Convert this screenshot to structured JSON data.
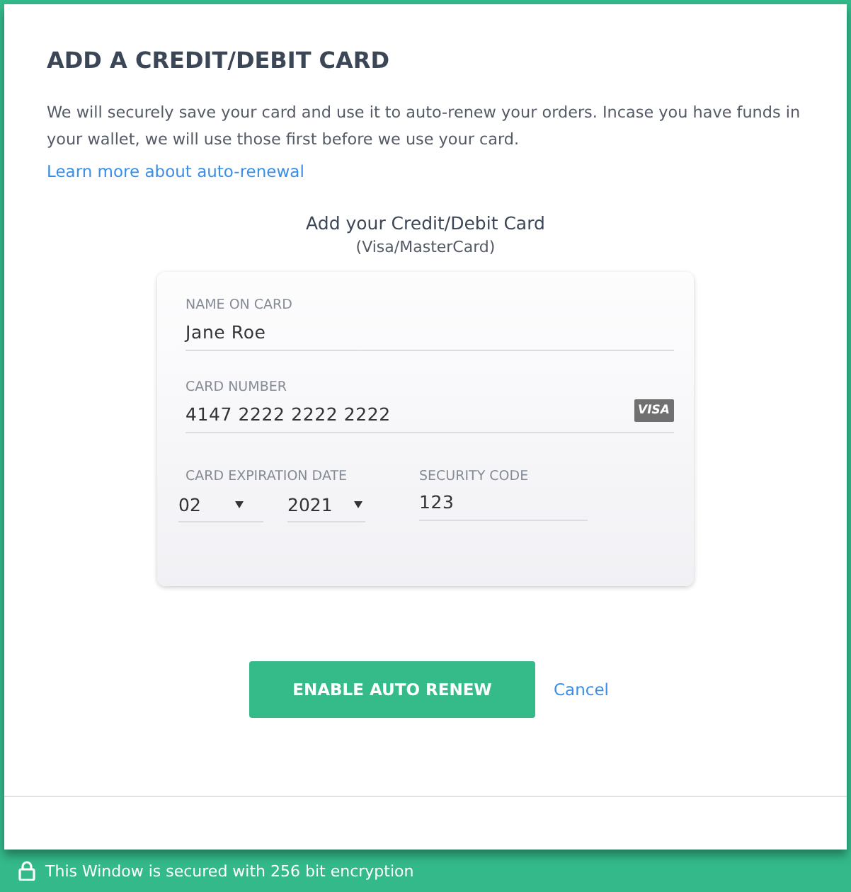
{
  "dialog": {
    "title": "ADD A CREDIT/DEBIT CARD",
    "description": "We will securely save your card and use it to auto-renew your orders. Incase you have funds in your wallet, we will use those first before we use your card.",
    "learn_more_link": "Learn more about auto-renewal",
    "card_heading": "Add your Credit/Debit Card",
    "card_subheading": "(Visa/MasterCard)",
    "card_form": {
      "name_on_card": {
        "label": "NAME ON CARD",
        "value": "Jane Roe"
      },
      "card_number": {
        "label": "CARD NUMBER",
        "value": "4147 2222 2222 2222",
        "brand_badge": "VISA"
      },
      "expiration": {
        "label": "CARD EXPIRATION DATE",
        "month": "02",
        "year": "2021"
      },
      "security_code": {
        "label": "SECURITY CODE",
        "value": "123"
      }
    },
    "primary_button": "ENABLE AUTO RENEW",
    "cancel_link": "Cancel"
  },
  "status_bar": {
    "text": "This Window is secured with 256 bit encryption"
  }
}
